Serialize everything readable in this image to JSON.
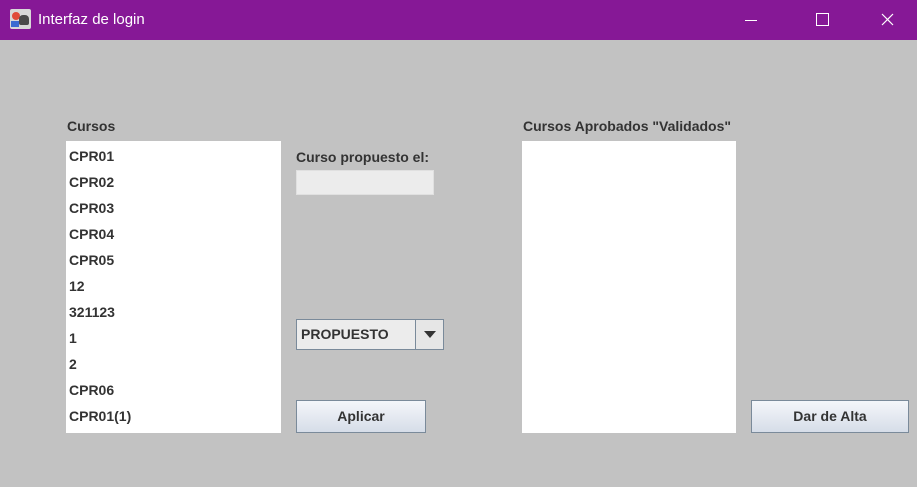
{
  "window": {
    "title": "Interfaz de login",
    "icon": "app-icon"
  },
  "cursos": {
    "label": "Cursos",
    "items": [
      "CPR01",
      "CPR02",
      "CPR03",
      "CPR04",
      "CPR05",
      "12",
      "321123",
      "1",
      "2",
      "CPR06",
      "CPR01(1)"
    ]
  },
  "propuesto": {
    "label": "Curso propuesto el:",
    "value": "",
    "combo_value": "PROPUESTO"
  },
  "aplicar_label": "Aplicar",
  "aprobados": {
    "label": "Cursos Aprobados \"Validados\"",
    "items": []
  },
  "alta_label": "Dar de Alta",
  "colors": {
    "titlebar": "#861896",
    "background": "#c2c2c2"
  }
}
